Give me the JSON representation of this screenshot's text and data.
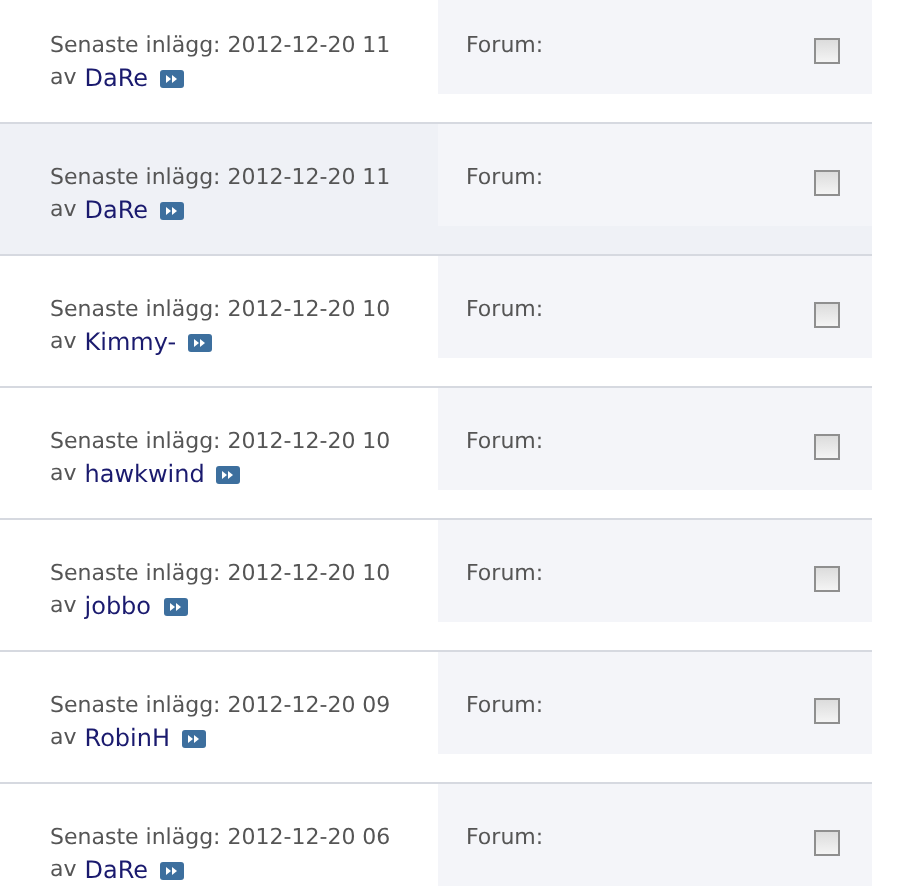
{
  "topics": [
    {
      "meta": "Senaste inlägg: 2012-12-20 11",
      "by": "av",
      "author": "DaRe",
      "forum_label": "Forum:",
      "highlighted": false,
      "checked": false
    },
    {
      "meta": "Senaste inlägg: 2012-12-20 11",
      "by": "av",
      "author": "DaRe",
      "forum_label": "Forum:",
      "highlighted": true,
      "checked": false
    },
    {
      "meta": "Senaste inlägg: 2012-12-20 10",
      "by": "av",
      "author": "Kimmy-",
      "forum_label": "Forum:",
      "highlighted": false,
      "checked": false
    },
    {
      "meta": "Senaste inlägg: 2012-12-20 10",
      "by": "av",
      "author": "hawkwind",
      "forum_label": "Forum:",
      "highlighted": false,
      "checked": false
    },
    {
      "meta": "Senaste inlägg: 2012-12-20 10",
      "by": "av",
      "author": "jobbo",
      "forum_label": "Forum:",
      "highlighted": false,
      "checked": false
    },
    {
      "meta": "Senaste inlägg: 2012-12-20 09",
      "by": "av",
      "author": "RobinH",
      "forum_label": "Forum:",
      "highlighted": false,
      "checked": false
    },
    {
      "meta": "Senaste inlägg: 2012-12-20 06",
      "by": "av",
      "author": "DaRe",
      "forum_label": "Forum:",
      "highlighted": false,
      "checked": false
    }
  ]
}
